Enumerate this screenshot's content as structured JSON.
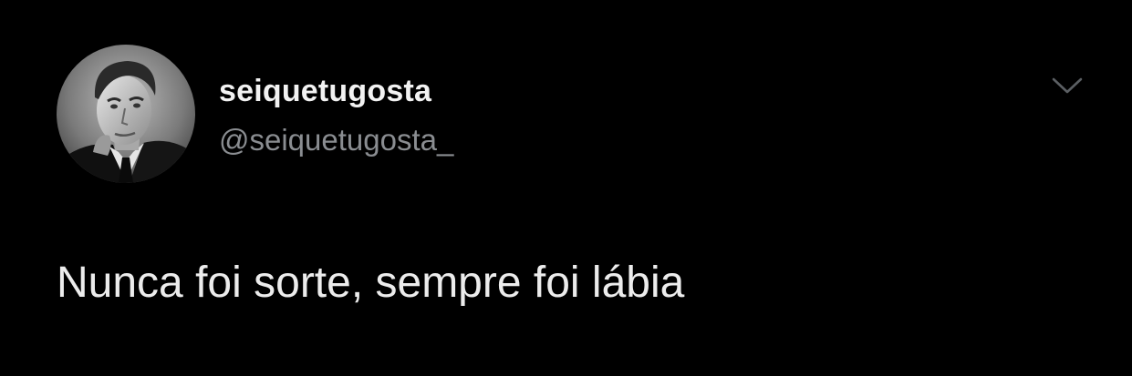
{
  "tweet": {
    "author": {
      "display_name": "seiquetugosta",
      "handle": "@seiquetugosta_",
      "avatar_icon": "profile-photo-bw-man"
    },
    "text": "Nunca foi sorte, sempre foi lábia",
    "menu_icon": "chevron-down-icon"
  },
  "colors": {
    "background": "#000000",
    "name": "#f2f2f2",
    "handle": "#8a8d91",
    "text": "#ececec",
    "chevron": "#5b5f63"
  }
}
